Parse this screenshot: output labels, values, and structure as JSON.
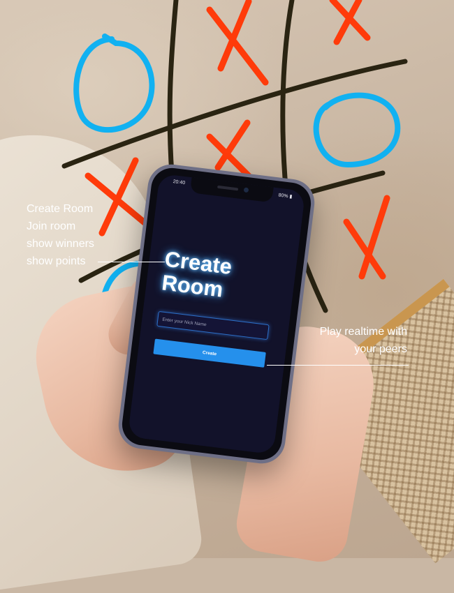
{
  "phone": {
    "status_time": "20:40",
    "status_battery": "80%",
    "screen_title": "Create Room",
    "nick_input_placeholder": "Enter your Nick Name",
    "create_button_label": "Create"
  },
  "features": {
    "items": [
      "Create Room",
      "Join room",
      "show winners",
      "show points"
    ]
  },
  "tagline": {
    "line1": "Play realtime with",
    "line2": "your peers"
  },
  "colors": {
    "x_mark": "#ff3b0a",
    "o_mark": "#11b1f1",
    "grid_lines": "#2a2412",
    "screen_bg": "#12122a",
    "button_bg": "#2590ec"
  }
}
